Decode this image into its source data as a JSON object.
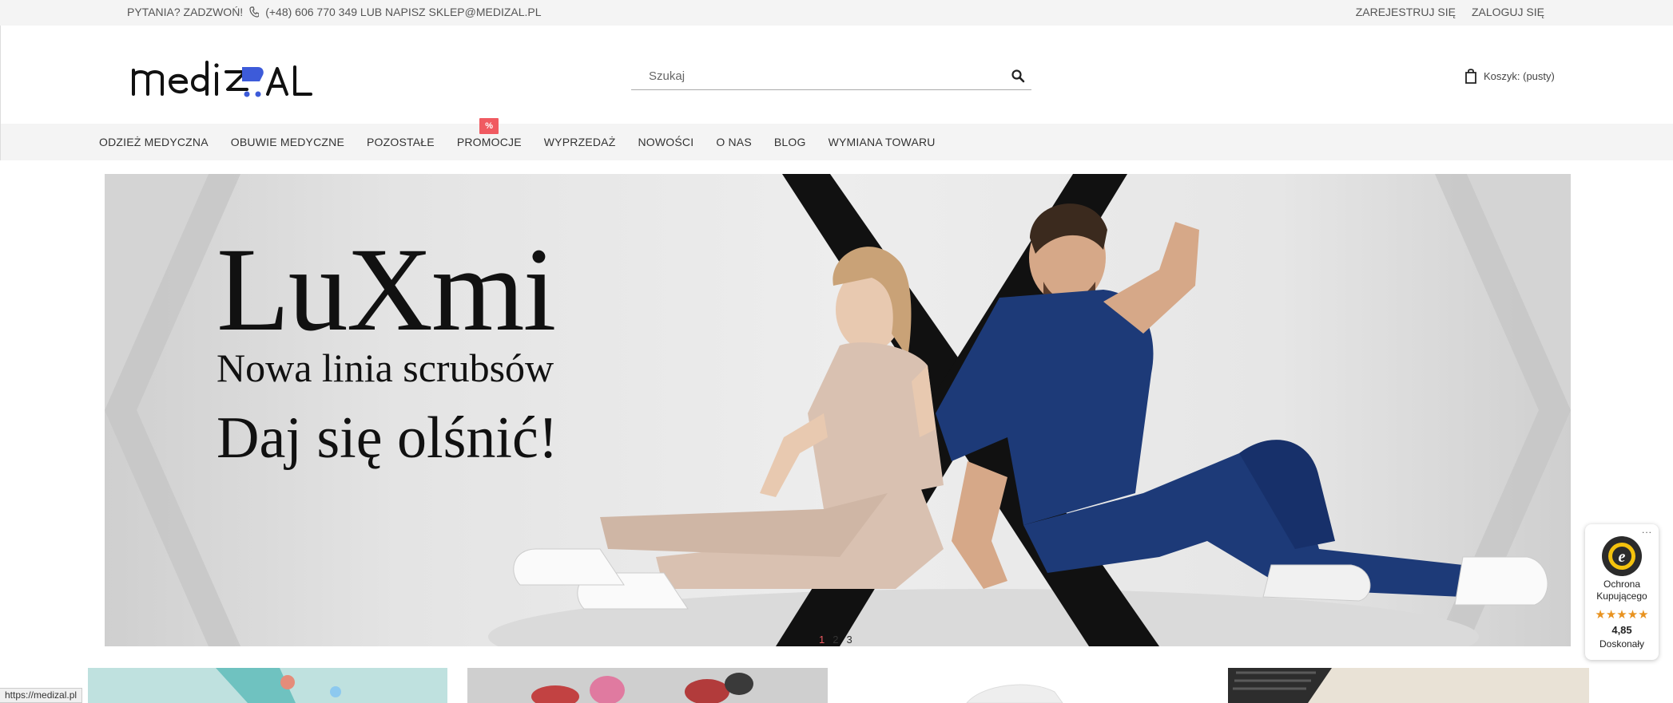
{
  "topbar": {
    "question": "PYTANIA? ZADZWOŃ!",
    "phone_and_email": "(+48) 606 770 349 LUB NAPISZ SKLEP@MEDIZAL.PL",
    "register": "ZAREJESTRUJ SIĘ",
    "login": "ZALOGUJ SIĘ"
  },
  "header": {
    "logo_text": "medizal",
    "search_placeholder": "Szukaj",
    "cart_label": "Koszyk: (pusty)"
  },
  "nav": {
    "items": [
      {
        "label": "ODZIEŻ MEDYCZNA"
      },
      {
        "label": "OBUWIE MEDYCZNE"
      },
      {
        "label": "POZOSTAŁE"
      },
      {
        "label": "PROMOCJE",
        "badge": "%"
      },
      {
        "label": "WYPRZEDAŻ"
      },
      {
        "label": "NOWOŚCI"
      },
      {
        "label": "O NAS"
      },
      {
        "label": "BLOG"
      },
      {
        "label": "WYMIANA TOWARU"
      }
    ]
  },
  "banner": {
    "title": "LuXmi",
    "subtitle": "Nowa linia scrubsów",
    "tagline": "Daj się olśnić!",
    "pagination": [
      "1",
      "2",
      "3"
    ],
    "active_slide": "1"
  },
  "trust_badge": {
    "line1": "Ochrona",
    "line2": "Kupującego",
    "stars": "★★★★★",
    "score": "4,85",
    "rating": "Doskonały",
    "more": "..."
  },
  "statusbar": {
    "url": "https://medizal.pl"
  },
  "colors": {
    "accent": "#f05a61",
    "logo_blue": "#3d5bd9",
    "nav_bg": "#f4f4f4",
    "scrub_navy": "#1d3a78",
    "scrub_beige": "#d9c1b1"
  },
  "icons": {
    "phone": "phone-icon",
    "search": "search-icon",
    "cart": "shopping-bag-icon",
    "trust": "trusted-shops-seal-icon"
  }
}
